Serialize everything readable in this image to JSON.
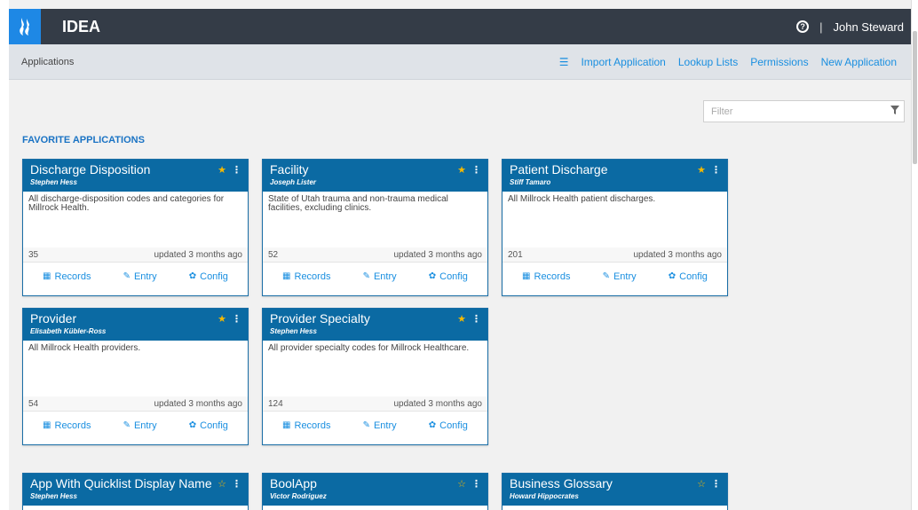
{
  "header": {
    "app_title": "IDEA",
    "help_symbol": "?",
    "separator": "|",
    "user_name": "John Steward",
    "logo_color": "#1e88e5"
  },
  "subnav": {
    "breadcrumb": "Applications",
    "import_label": "Import Application",
    "lookup_label": "Lookup Lists",
    "permissions_label": "Permissions",
    "new_label": "New Application"
  },
  "filter": {
    "placeholder": "Filter",
    "value": ""
  },
  "favorites_title": "FAVORITE APPLICATIONS",
  "cards": [
    {
      "title": "Discharge Disposition",
      "author": "Stephen Hess",
      "desc": "All discharge-disposition codes and categories for Millrock Health.",
      "count": "35",
      "updated": "updated 3 months ago",
      "records": "Records",
      "entry": "Entry",
      "config": "Config"
    },
    {
      "title": "Facility",
      "author": "Joseph Lister",
      "desc": "State of Utah trauma and non-trauma medical facilities, excluding clinics.",
      "count": "52",
      "updated": "updated 3 months ago",
      "records": "Records",
      "entry": "Entry",
      "config": "Config"
    },
    {
      "title": "Patient Discharge",
      "author": "Stiff Tamaro",
      "desc": "All Millrock Health patient discharges.",
      "count": "201",
      "updated": "updated 3 months ago",
      "records": "Records",
      "entry": "Entry",
      "config": "Config"
    },
    {
      "title": "Provider",
      "author": "Elisabeth Kübler-Ross",
      "desc": "All Millrock Health providers.",
      "count": "54",
      "updated": "updated 3 months ago",
      "records": "Records",
      "entry": "Entry",
      "config": "Config"
    },
    {
      "title": "Provider Specialty",
      "author": "Stephen Hess",
      "desc": "All provider specialty codes for Millrock Healthcare.",
      "count": "124",
      "updated": "updated 3 months ago",
      "records": "Records",
      "entry": "Entry",
      "config": "Config"
    },
    {
      "title": "App With Quicklist Display Name",
      "author": "Stephen Hess",
      "desc": "",
      "count": "",
      "updated": "",
      "records": "",
      "entry": "",
      "config": ""
    },
    {
      "title": "BoolApp",
      "author": "Victor Rodriguez",
      "desc": "",
      "count": "",
      "updated": "",
      "records": "",
      "entry": "",
      "config": ""
    },
    {
      "title": "Business Glossary",
      "author": "Howard Hippocrates",
      "desc": "",
      "count": "",
      "updated": "",
      "records": "",
      "entry": "",
      "config": ""
    }
  ]
}
